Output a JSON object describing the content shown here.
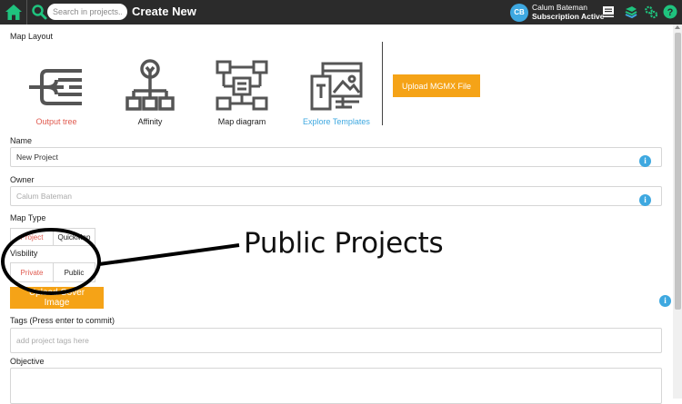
{
  "topbar": {
    "search_placeholder": "Search in projects...",
    "page_title": "Create New",
    "user": {
      "initials": "CB",
      "name": "Calum Bateman",
      "status": "Subscription Active"
    },
    "icons": [
      "home-icon",
      "search-icon",
      "chat-icon",
      "layers-icon",
      "settings-icon",
      "help-icon"
    ],
    "accent_color": "#1fc37e"
  },
  "map_layout": {
    "label": "Map Layout",
    "options": [
      {
        "label": "Output tree",
        "icon": "output-tree-icon",
        "color": "#e05a4f"
      },
      {
        "label": "Affinity",
        "icon": "affinity-icon",
        "color": "#333333"
      },
      {
        "label": "Map diagram",
        "icon": "map-diagram-icon",
        "color": "#333333"
      },
      {
        "label": "Explore Templates",
        "icon": "templates-icon",
        "color": "#3ea8e0"
      }
    ],
    "upload_label": "Upload MGMX File"
  },
  "name": {
    "label": "Name",
    "value": "New Project"
  },
  "owner": {
    "label": "Owner",
    "placeholder": "Calum Bateman"
  },
  "map_type": {
    "label": "Map Type",
    "options": [
      "Project",
      "QuickMap"
    ],
    "selected": "Project"
  },
  "visibility": {
    "label": "Visbility",
    "options": [
      "Private",
      "Public"
    ],
    "selected": "Private"
  },
  "upload_cover_label": "Upload Cover Image",
  "tags": {
    "label": "Tags (Press enter to commit)",
    "placeholder": "add project tags here"
  },
  "objective": {
    "label": "Objective"
  },
  "annotation": {
    "text": "Public Projects"
  },
  "colors": {
    "orange": "#f5a317",
    "info_blue": "#3ea8e0",
    "selected_red": "#e05a4f"
  }
}
